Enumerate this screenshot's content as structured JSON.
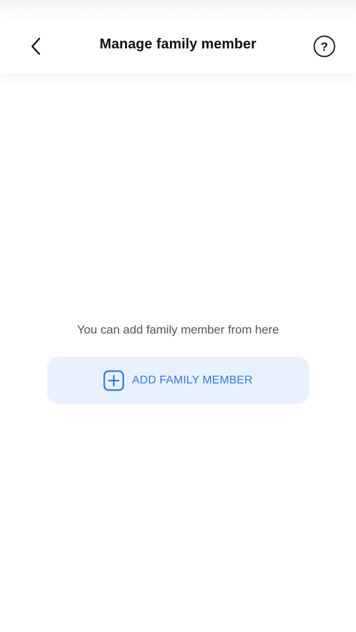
{
  "header": {
    "title": "Manage family member",
    "back_icon": "chevron-left-icon",
    "help_icon": "question-circle-icon",
    "help_symbol": "?"
  },
  "main": {
    "empty_message": "You can add family member from here",
    "add_button": {
      "label": "ADD FAMILY MEMBER",
      "icon": "plus-square-icon"
    }
  },
  "colors": {
    "accent": "#2f7bd8",
    "button_bg": "#e8f1fd",
    "title": "#111111",
    "muted_text": "#555555"
  }
}
